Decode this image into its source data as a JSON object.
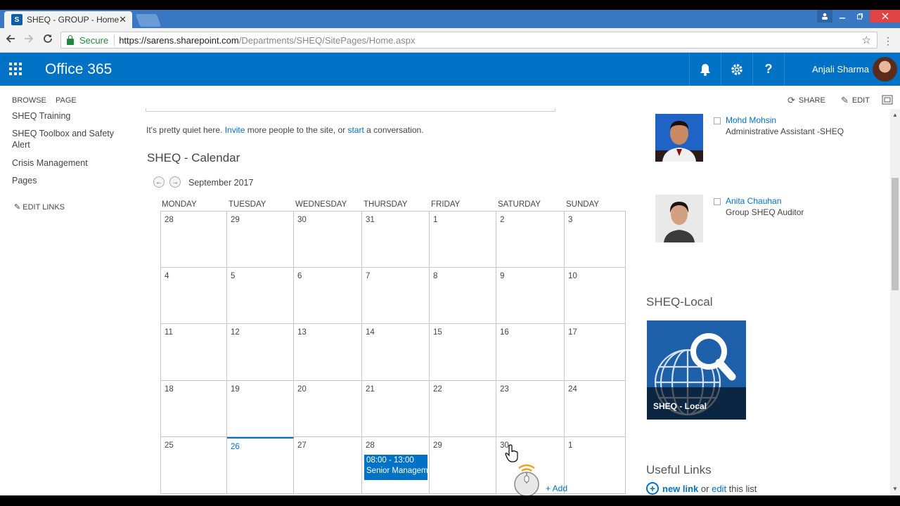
{
  "browser": {
    "tab_title": "SHEQ - GROUP - Home",
    "tab_favicon": "S",
    "tab_close": "✕",
    "secure_label": "Secure",
    "url_host": "https://sarens.sharepoint.com",
    "url_path": "/Departments/SHEQ/SitePages/Home.aspx"
  },
  "suitebar": {
    "brand": "Office 365",
    "user_name": "Anjali Sharma",
    "bell": "🔔",
    "gear": "⚙",
    "help": "?"
  },
  "ribbon": {
    "browse": "BROWSE",
    "page": "PAGE",
    "share": "SHARE",
    "edit": "EDIT"
  },
  "leftnav": {
    "items": [
      "SHEQ Training",
      "SHEQ Toolbox and Safety Alert",
      "Crisis Management",
      "Pages"
    ],
    "edit_links": "EDIT LINKS"
  },
  "newsfeed": {
    "quiet_pre": "It's pretty quiet here. ",
    "invite": "Invite",
    "quiet_mid": " more people to the site, or ",
    "start": "start",
    "quiet_post": " a conversation."
  },
  "calendar": {
    "title": "SHEQ - Calendar",
    "month": "September 2017",
    "prev": "←",
    "next": "→",
    "days": [
      "MONDAY",
      "TUESDAY",
      "WEDNESDAY",
      "THURSDAY",
      "FRIDAY",
      "SATURDAY",
      "SUNDAY"
    ],
    "weeks": [
      [
        "28",
        "29",
        "30",
        "31",
        "1",
        "2",
        "3"
      ],
      [
        "4",
        "5",
        "6",
        "7",
        "8",
        "9",
        "10"
      ],
      [
        "11",
        "12",
        "13",
        "14",
        "15",
        "16",
        "17"
      ],
      [
        "18",
        "19",
        "20",
        "21",
        "22",
        "23",
        "24"
      ],
      [
        "25",
        "26",
        "27",
        "28",
        "29",
        "30",
        "1"
      ]
    ],
    "today": "26",
    "event_time": "08:00 - 13:00",
    "event_title": "Senior Managem",
    "add": "+ Add",
    "accent": "#0072c6"
  },
  "contacts": [
    {
      "name": "Mohd Mohsin",
      "role": "Administrative Assistant -SHEQ"
    },
    {
      "name": "Anita Chauhan",
      "role": "Group SHEQ Auditor"
    }
  ],
  "sheq_local": {
    "title": "SHEQ-Local",
    "tile_label": "SHEQ - Local"
  },
  "useful_links": {
    "title": "Useful Links",
    "new_link": "new link",
    "or": " or ",
    "edit": "edit",
    "this_list": " this list"
  }
}
